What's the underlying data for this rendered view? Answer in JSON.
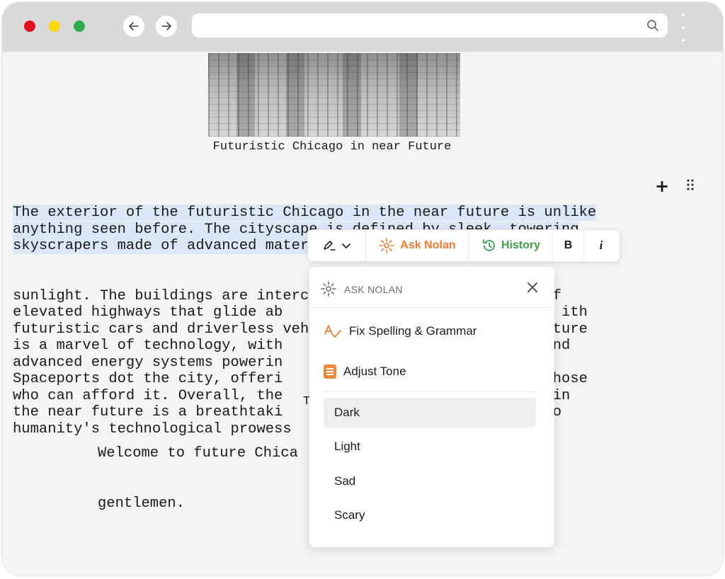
{
  "figure": {
    "caption": "Futuristic Chicago in near Future"
  },
  "document": {
    "highlighted_lines": [
      "The exterior of the futuristic Chicago in the near future is unlike",
      "anything seen before. The cityscape is defined by sleek, towering",
      "skyscrapers made of advanced materials that shimmer in the"
    ],
    "lines": [
      "sunlight. The buildings are interconnected through a network of",
      "elevated highways that glide ab                                ith",
      "futuristic cars and driverless vehicles. The city's infrastructure",
      "is a marvel of technology, with                       works, and",
      "advanced energy systems powerin                            fe.",
      "Spaceports dot the city, offeri                          for those",
      "who can afford it. Overall, the                         icago in",
      "the near future is a breathtaki                        ament to",
      "humanity's technological prowess"
    ],
    "scene_heading_char": "T",
    "dialogue": [
      "Welcome to future Chica",
      "gentlemen."
    ]
  },
  "toolbar": {
    "ask_label": "Ask Nolan",
    "history_label": "History",
    "bold_label": "B",
    "italic_label": "i"
  },
  "menu": {
    "title": "ASK NOLAN",
    "fix_label": "Fix Spelling & Grammar",
    "tone_label": "Adjust Tone",
    "tones": [
      "Dark",
      "Light",
      "Sad",
      "Scary"
    ],
    "selected_tone": "Dark"
  },
  "colors": {
    "accent_orange": "#ef7a2e",
    "history_green": "#3e9e4a",
    "selection_blue": "#dbe7f6"
  }
}
